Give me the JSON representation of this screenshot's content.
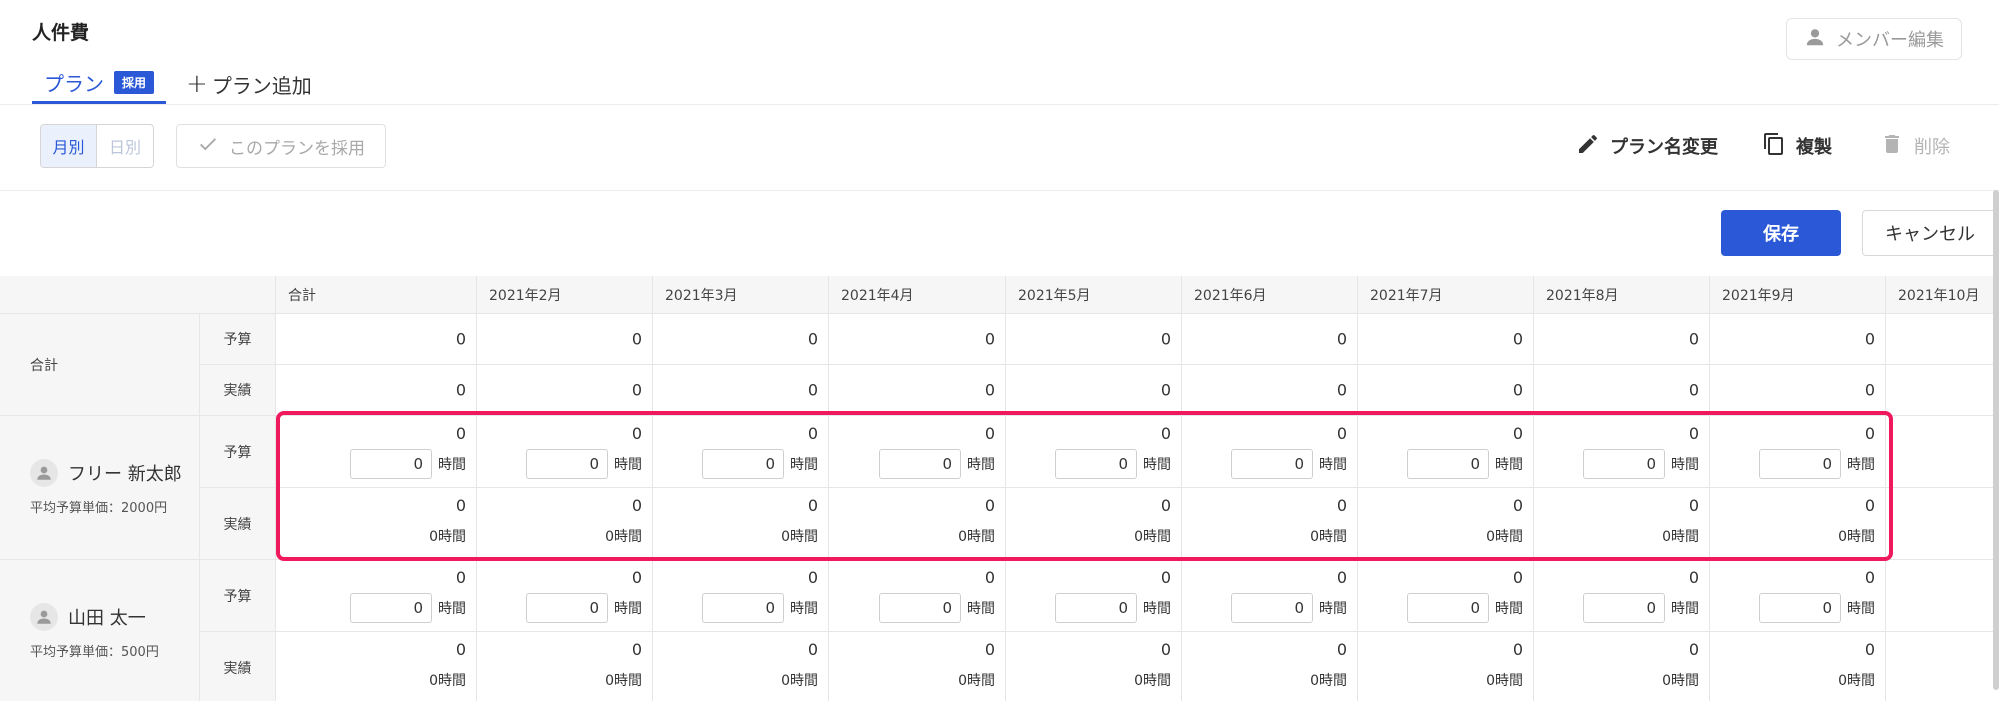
{
  "header": {
    "title": "人件費",
    "member_edit_label": "メンバー編集"
  },
  "tabs": {
    "plan_label": "プラン",
    "plan_badge": "採用",
    "add_label": "プラン追加"
  },
  "toolbar": {
    "monthly": "月別",
    "daily": "日別",
    "adopt_plan": "このプランを採用",
    "rename": "プラン名変更",
    "duplicate": "複製",
    "delete": "削除",
    "save": "保存",
    "cancel": "キャンセル"
  },
  "table": {
    "columns": [
      "合計",
      "2021年2月",
      "2021年3月",
      "2021年4月",
      "2021年5月",
      "2021年6月",
      "2021年7月",
      "2021年8月",
      "2021年9月",
      "2021年10月"
    ],
    "budget_label": "予算",
    "actual_label": "実績",
    "hours_unit": "時間",
    "total_group": {
      "label": "合計",
      "budget": [
        "0",
        "0",
        "0",
        "0",
        "0",
        "0",
        "0",
        "0",
        "0"
      ],
      "actual": [
        "0",
        "0",
        "0",
        "0",
        "0",
        "0",
        "0",
        "0",
        "0"
      ]
    },
    "members": [
      {
        "name": "フリー 新太郎",
        "subtitle": "平均予算単価：2000円",
        "budget": [
          "0",
          "0",
          "0",
          "0",
          "0",
          "0",
          "0",
          "0",
          "0"
        ],
        "budget_hours": [
          "0",
          "0",
          "0",
          "0",
          "0",
          "0",
          "0",
          "0",
          "0"
        ],
        "actual": [
          "0",
          "0",
          "0",
          "0",
          "0",
          "0",
          "0",
          "0",
          "0"
        ],
        "actual_hours": [
          "0時間",
          "0時間",
          "0時間",
          "0時間",
          "0時間",
          "0時間",
          "0時間",
          "0時間",
          "0時間"
        ]
      },
      {
        "name": "山田 太一",
        "subtitle": "平均予算単価：500円",
        "budget": [
          "0",
          "0",
          "0",
          "0",
          "0",
          "0",
          "0",
          "0",
          "0"
        ],
        "budget_hours": [
          "0",
          "0",
          "0",
          "0",
          "0",
          "0",
          "0",
          "0",
          "0"
        ],
        "actual": [
          "0",
          "0",
          "0",
          "0",
          "0",
          "0",
          "0",
          "0",
          "0"
        ],
        "actual_hours": [
          "0時間",
          "0時間",
          "0時間",
          "0時間",
          "0時間",
          "0時間",
          "0時間",
          "0時間",
          "0時間"
        ]
      }
    ]
  },
  "icons": {
    "member": "person-icon",
    "adopt": "check-icon",
    "rename": "pencil-icon",
    "duplicate": "copy-icon",
    "delete": "trash-icon"
  },
  "colors": {
    "accent": "#2a58d6",
    "highlight": "#f0195e"
  }
}
